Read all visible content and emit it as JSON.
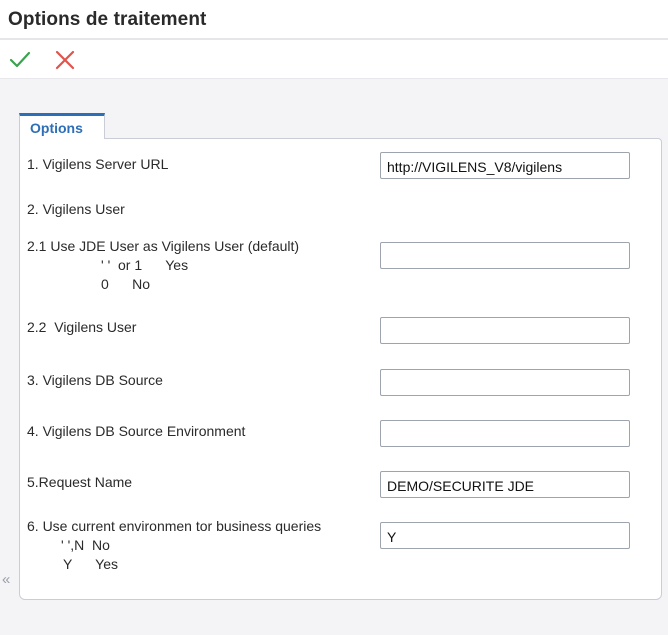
{
  "header": {
    "title": "Options de traitement"
  },
  "toolbar": {
    "ok_icon": "checkmark-icon",
    "cancel_icon": "close-icon",
    "ok_color": "#3aa34f",
    "cancel_color": "#e2534b"
  },
  "side": {
    "collapse_glyph": "«"
  },
  "tabs": [
    {
      "label": "Options",
      "active": true
    }
  ],
  "options": {
    "server_url": {
      "label": "1. Vigilens Server URL",
      "value": "http://VIGILENS_V8/vigilens"
    },
    "vigilens_user_heading": {
      "label": "2. Vigilens User"
    },
    "use_jde_user": {
      "label": "2.1 Use JDE User as Vigilens User (default)",
      "hint_line1": "' '  or 1      Yes",
      "hint_line2": "0      No",
      "value": ""
    },
    "vigilens_user": {
      "label": "2.2  Vigilens User",
      "value": ""
    },
    "db_source": {
      "label": "3. Vigilens DB Source",
      "value": ""
    },
    "db_source_env": {
      "label": "4. Vigilens DB Source Environment",
      "value": ""
    },
    "request_name": {
      "label": "5.Request Name",
      "value": "DEMO/SECURITE JDE"
    },
    "current_env": {
      "label": "6. Use current environmen tor business queries",
      "hint_line1": "' ',N  No",
      "hint_line2": "Y      Yes",
      "value": "Y"
    }
  }
}
